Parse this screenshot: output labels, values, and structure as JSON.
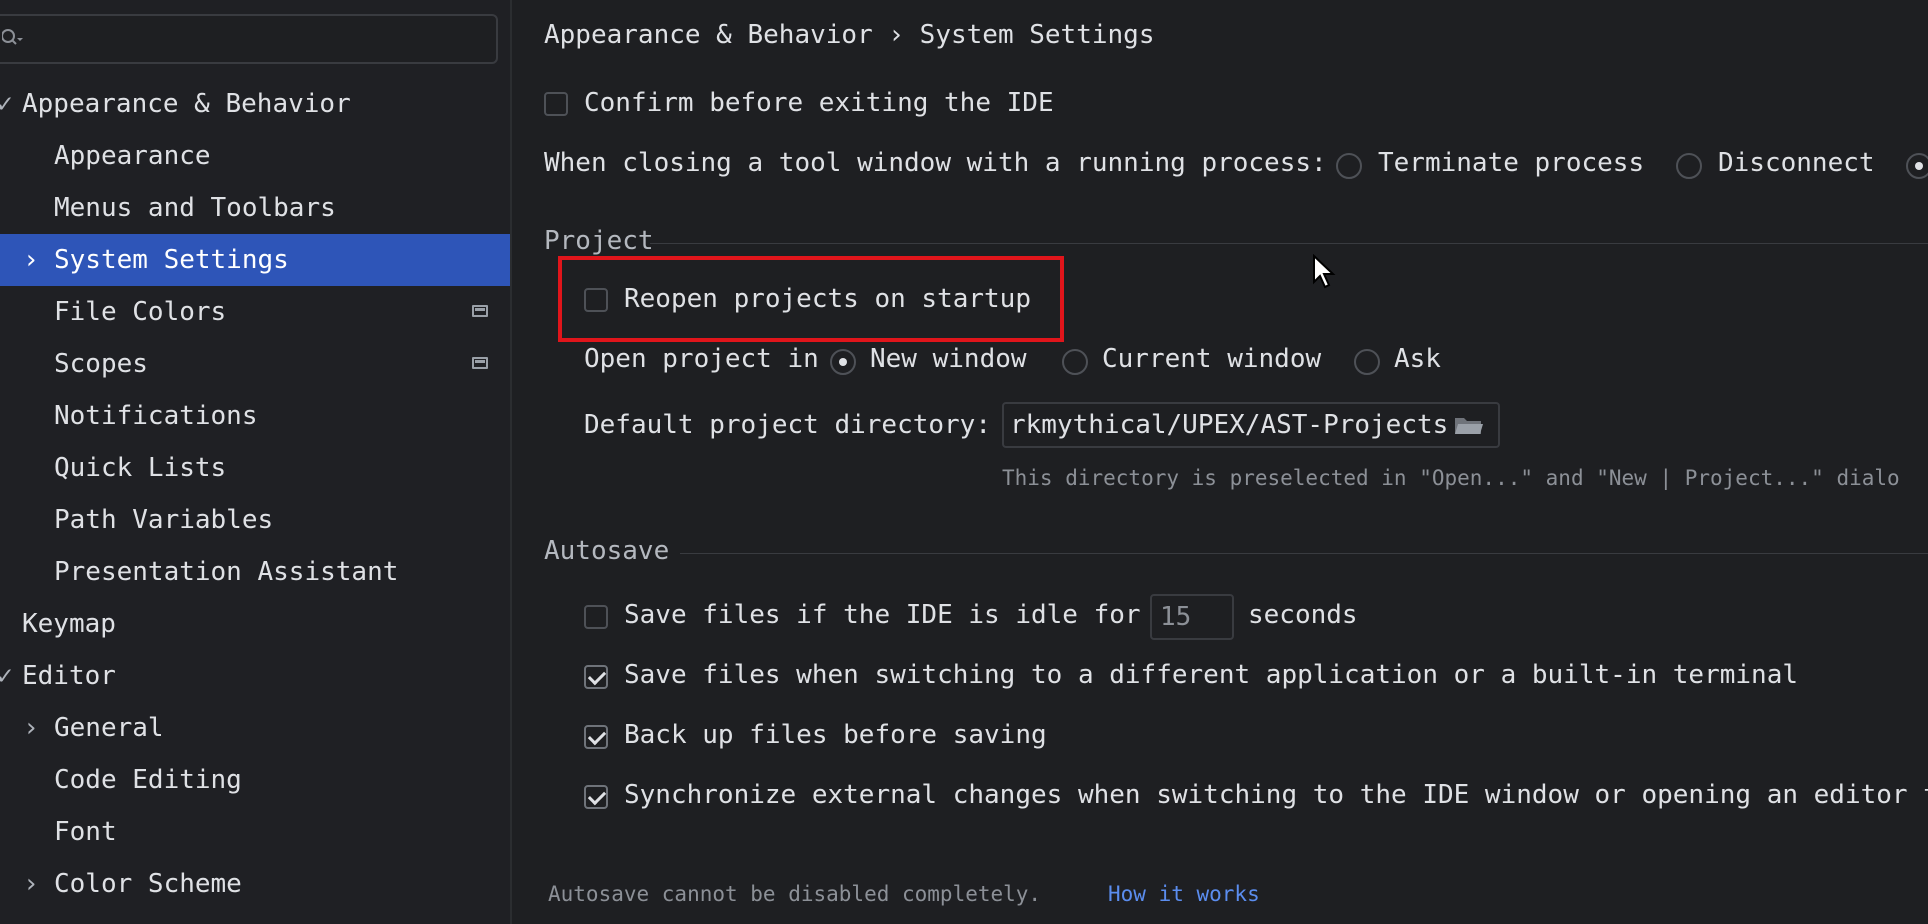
{
  "search": {
    "placeholder": ""
  },
  "sidebar": {
    "items": [
      {
        "label": "Appearance & Behavior",
        "arrow": "✓"
      },
      {
        "label": "Appearance"
      },
      {
        "label": "Menus and Toolbars"
      },
      {
        "label": "System Settings",
        "arrow": "›",
        "selected": true
      },
      {
        "label": "File Colors",
        "project_icon": true
      },
      {
        "label": "Scopes",
        "project_icon": true
      },
      {
        "label": "Notifications"
      },
      {
        "label": "Quick Lists"
      },
      {
        "label": "Path Variables"
      },
      {
        "label": "Presentation Assistant"
      },
      {
        "label": "Keymap"
      },
      {
        "label": "Editor",
        "arrow": "✓"
      },
      {
        "label": "General",
        "arrow": "›"
      },
      {
        "label": "Code Editing"
      },
      {
        "label": "Font"
      },
      {
        "label": "Color Scheme",
        "arrow": "›"
      }
    ]
  },
  "main": {
    "breadcrumb": "Appearance & Behavior › System Settings",
    "confirm_exit": {
      "label": "Confirm before exiting the IDE",
      "checked": false
    },
    "closing_tool_window": {
      "label": "When closing a tool window with a running process:",
      "options": [
        "Terminate process",
        "Disconnect"
      ]
    },
    "project_section": {
      "title": "Project",
      "reopen": {
        "label": "Reopen projects on startup",
        "checked": false
      },
      "open_project_in": {
        "label": "Open project in",
        "options": [
          "New window",
          "Current window",
          "Ask"
        ],
        "selected": "New window"
      },
      "default_dir": {
        "label": "Default project directory:",
        "value": "rkmythical/UPEX/AST-Projects",
        "hint": "This directory is preselected in \"Open...\" and \"New | Project...\" dialo"
      }
    },
    "autosave_section": {
      "title": "Autosave",
      "idle": {
        "label_before": "Save files if the IDE is idle for",
        "value": "15",
        "label_after": "seconds",
        "checked": false
      },
      "switch_app": {
        "label": "Save files when switching to a different application or a built-in terminal",
        "checked": true
      },
      "backup": {
        "label": "Back up files before saving",
        "checked": true
      },
      "sync": {
        "label": "Synchronize external changes when switching to the IDE window or opening an editor t",
        "checked": true
      },
      "note": "Autosave cannot be disabled completely.",
      "link": "How it works"
    }
  },
  "colors": {
    "accent": "#2e55b8",
    "highlight": "#e0151b",
    "link": "#5b8def"
  }
}
